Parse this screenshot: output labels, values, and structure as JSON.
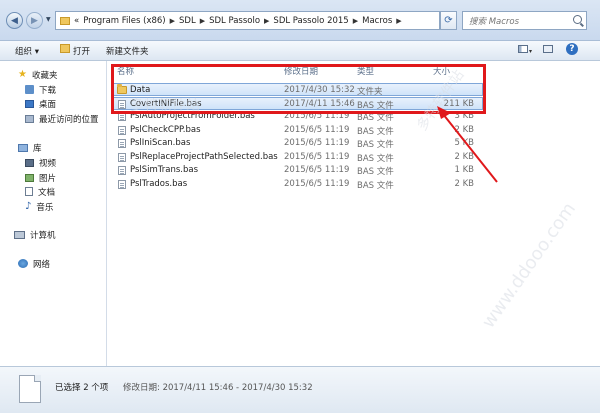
{
  "address": {
    "overflow": "«",
    "segments": [
      "Program Files (x86)",
      "SDL",
      "SDL Passolo",
      "SDL Passolo 2015",
      "Macros"
    ],
    "separator": "▶",
    "search_placeholder": "搜索 Macros"
  },
  "toolbar": {
    "organize": "组织 ▾",
    "open": "打开",
    "new_folder": "新建文件夹"
  },
  "sidebar": {
    "favorites": "收藏夹",
    "favorites_items": [
      "下载",
      "桌面",
      "最近访问的位置"
    ],
    "libraries": "库",
    "libraries_items": [
      "视频",
      "图片",
      "文档",
      "音乐"
    ],
    "computer": "计算机",
    "network": "网络"
  },
  "columns": {
    "name": "名称",
    "date": "修改日期",
    "type": "类型",
    "size": "大小"
  },
  "files": [
    {
      "name": "Data",
      "date": "2017/4/30 15:32",
      "type": "文件夹",
      "size": "",
      "icon": "folder-icon",
      "selected": true
    },
    {
      "name": "CovertINIFile.bas",
      "date": "2017/4/11 15:46",
      "type": "BAS 文件",
      "size": "211 KB",
      "icon": "file-icon",
      "selected": true
    },
    {
      "name": "PslAutoProjectFromFolder.bas",
      "date": "2015/6/5 11:19",
      "type": "BAS 文件",
      "size": "3 KB",
      "icon": "file-icon",
      "selected": false
    },
    {
      "name": "PslCheckCPP.bas",
      "date": "2015/6/5 11:19",
      "type": "BAS 文件",
      "size": "2 KB",
      "icon": "file-icon",
      "selected": false
    },
    {
      "name": "PslIniScan.bas",
      "date": "2015/6/5 11:19",
      "type": "BAS 文件",
      "size": "5 KB",
      "icon": "file-icon",
      "selected": false
    },
    {
      "name": "PslReplaceProjectPathSelected.bas",
      "date": "2015/6/5 11:19",
      "type": "BAS 文件",
      "size": "2 KB",
      "icon": "file-icon",
      "selected": false
    },
    {
      "name": "PslSimTrans.bas",
      "date": "2015/6/5 11:19",
      "type": "BAS 文件",
      "size": "1 KB",
      "icon": "file-icon",
      "selected": false
    },
    {
      "name": "PslTrados.bas",
      "date": "2015/6/5 11:19",
      "type": "BAS 文件",
      "size": "2 KB",
      "icon": "file-icon",
      "selected": false
    }
  ],
  "status": {
    "selected": "已选择 2 个项",
    "modified": "修改日期: 2017/4/11 15:46 - 2017/4/30 15:32"
  },
  "watermark": {
    "text": "多特软件站",
    "url": "www.ddooo.com"
  },
  "colors": {
    "annotation": "#e0181b",
    "selection": "#cfe3f9"
  }
}
